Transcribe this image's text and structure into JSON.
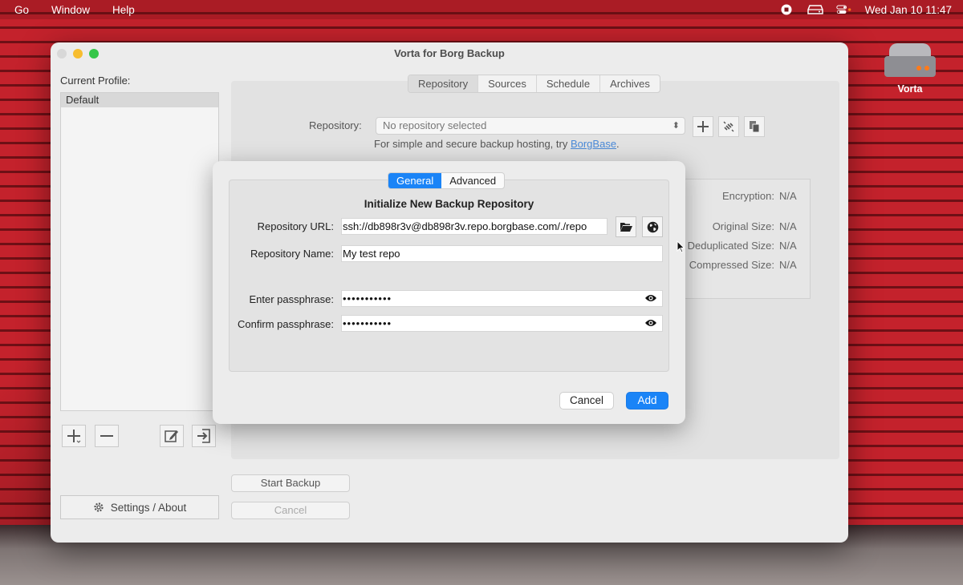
{
  "menubar": {
    "items": [
      "Go",
      "Window",
      "Help"
    ],
    "clock": "Wed Jan 10  11:47",
    "icons": [
      "record-icon",
      "drive-icon",
      "control-center-icon"
    ]
  },
  "desktop": {
    "icon_label": "Vorta"
  },
  "window": {
    "title": "Vorta for Borg Backup",
    "current_profile_label": "Current Profile:",
    "profiles": [
      "Default"
    ],
    "settings_label": "Settings / About",
    "tabs": [
      "Repository",
      "Sources",
      "Schedule",
      "Archives"
    ],
    "repository_label": "Repository:",
    "repository_value": "No repository selected",
    "hosting_text": "For simple and secure backup hosting, try ",
    "hosting_link": "BorgBase",
    "hosting_suffix": ".",
    "stats": {
      "encryption_label": "Encryption:",
      "encryption_value": "N/A",
      "original_label": "Original Size:",
      "original_value": "N/A",
      "dedup_label": "Deduplicated Size:",
      "dedup_value": "N/A",
      "compressed_label": "Compressed Size:",
      "compressed_value": "N/A"
    },
    "start_backup_label": "Start Backup",
    "cancel_label": "Cancel"
  },
  "dialog": {
    "tabs": [
      "General",
      "Advanced"
    ],
    "heading": "Initialize New Backup Repository",
    "url_label": "Repository URL:",
    "url_value": "ssh://db898r3v@db898r3v.repo.borgbase.com/./repo",
    "name_label": "Repository Name:",
    "name_value": "My test repo",
    "pass_label": "Enter passphrase:",
    "pass_value": "•••••••••••",
    "confirm_label": "Confirm passphrase:",
    "confirm_value": "•••••••••••",
    "cancel_label": "Cancel",
    "add_label": "Add"
  },
  "colors": {
    "accent": "#1a84f7",
    "link": "#4a8ad8",
    "wall": "#c4222c"
  }
}
